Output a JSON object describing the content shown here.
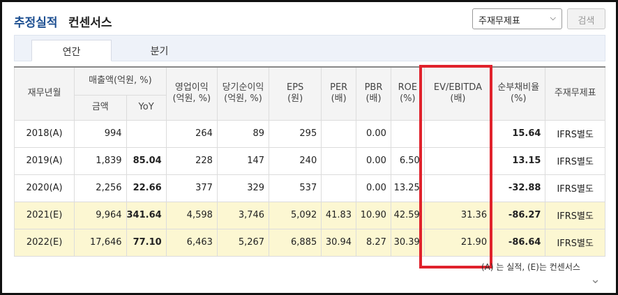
{
  "header": {
    "title_main": "추정실적",
    "title_sub": "컨센서스",
    "standard_select": "주재무제표",
    "search_label": "검색",
    "colors": {
      "title": "#1d4f91",
      "highlight": "#e0222c",
      "estimate_bg": "#fcf7d2",
      "negative": "#c81e1e"
    }
  },
  "tabs": [
    {
      "label": "연간",
      "active": true
    },
    {
      "label": "분기",
      "active": false
    }
  ],
  "table": {
    "headers": {
      "period": "재무년월",
      "sales": "매출액(억원, %)",
      "sales_amount": "금액",
      "sales_yoy": "YoY",
      "op_income": "영업이익",
      "op_income_unit": "(억원, %)",
      "net_income": "당기순이익",
      "net_income_unit": "(억원, %)",
      "eps": "EPS",
      "eps_unit": "(원)",
      "per": "PER",
      "per_unit": "(배)",
      "pbr": "PBR",
      "pbr_unit": "(배)",
      "roe": "ROE",
      "roe_unit": "(%)",
      "ev_ebitda": "EV/EBITDA",
      "ev_ebitda_unit": "(배)",
      "debt_ratio": "순부채비율",
      "debt_ratio_unit": "(%)",
      "std": "주재무제표"
    },
    "rows": [
      {
        "period": "2018(A)",
        "amount": "994",
        "yoy": "",
        "op": "264",
        "net": "89",
        "eps": "295",
        "per": "",
        "pbr": "0.00",
        "roe": "",
        "ev": "",
        "debt": "15.64",
        "std": "IFRS별도"
      },
      {
        "period": "2019(A)",
        "amount": "1,839",
        "yoy": "85.04",
        "op": "228",
        "net": "147",
        "eps": "240",
        "per": "",
        "pbr": "0.00",
        "roe": "6.50",
        "ev": "",
        "debt": "13.15",
        "std": "IFRS별도"
      },
      {
        "period": "2020(A)",
        "amount": "2,256",
        "yoy": "22.66",
        "op": "377",
        "net": "329",
        "eps": "537",
        "per": "",
        "pbr": "0.00",
        "roe": "13.25",
        "ev": "",
        "debt": "-32.88",
        "std": "IFRS별도"
      },
      {
        "period": "2021(E)",
        "amount": "9,964",
        "yoy": "341.64",
        "op": "4,598",
        "net": "3,746",
        "eps": "5,092",
        "per": "41.83",
        "pbr": "10.90",
        "roe": "42.59",
        "ev": "31.36",
        "debt": "-86.27",
        "std": "IFRS별도"
      },
      {
        "period": "2022(E)",
        "amount": "17,646",
        "yoy": "77.10",
        "op": "6,463",
        "net": "5,267",
        "eps": "6,885",
        "per": "30.94",
        "pbr": "8.27",
        "roe": "30.39",
        "ev": "21.90",
        "debt": "-86.64",
        "std": "IFRS별도"
      }
    ]
  },
  "footnote": "(A) 는 실적, (E)는 컨센서스"
}
